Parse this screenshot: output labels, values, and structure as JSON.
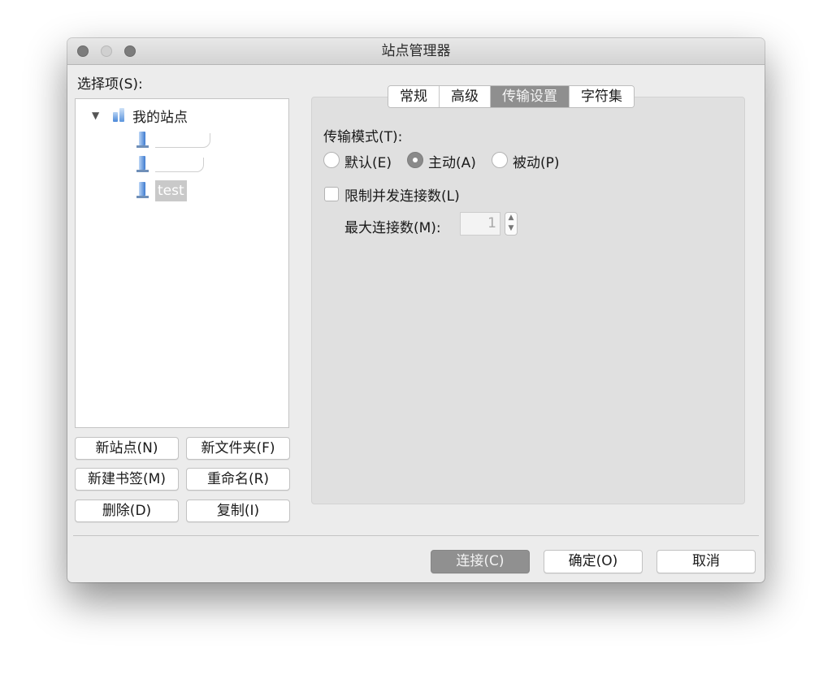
{
  "window": {
    "title": "站点管理器"
  },
  "left": {
    "select_label": "选择项(S):",
    "tree": {
      "root": "我的站点",
      "sites": [
        "",
        "",
        "test"
      ]
    },
    "buttons": {
      "new_site": "新站点(N)",
      "new_folder": "新文件夹(F)",
      "new_bookmark": "新建书签(M)",
      "rename": "重命名(R)",
      "delete": "删除(D)",
      "copy": "复制(I)"
    }
  },
  "tabs": [
    "常规",
    "高级",
    "传输设置",
    "字符集"
  ],
  "active_tab": "传输设置",
  "transfer": {
    "mode_label": "传输模式(T):",
    "modes": [
      "默认(E)",
      "主动(A)",
      "被动(P)"
    ],
    "selected_mode": "主动(A)",
    "limit_label": "限制并发连接数(L)",
    "limit_checked": false,
    "max_label": "最大连接数(M):",
    "max_value": "1"
  },
  "footer": {
    "connect": "连接(C)",
    "ok": "确定(O)",
    "cancel": "取消"
  },
  "colors": {
    "window_bg": "#ececec",
    "panel_bg": "#e0e0e0",
    "active_tab": "#8f8f8f"
  }
}
